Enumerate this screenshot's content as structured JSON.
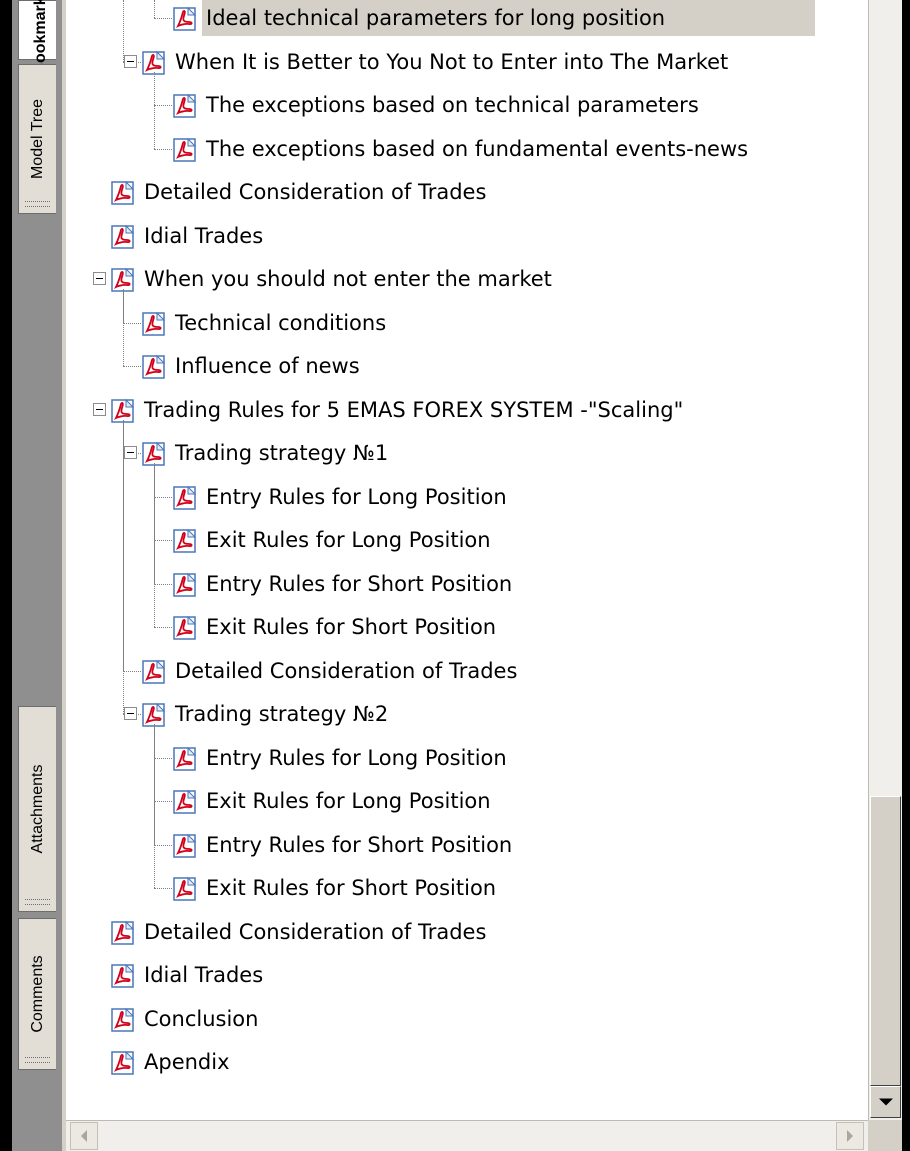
{
  "tabs": [
    {
      "label": "Bookmarks"
    },
    {
      "label": "Model Tree"
    },
    {
      "label": "Attachments"
    },
    {
      "label": "Comments"
    }
  ],
  "tree": [
    {
      "label": "Ideal technical parameters for long position",
      "level": 2,
      "expandable": false
    },
    {
      "label": "When It is Better to You Not to Enter into The Market",
      "level": 1,
      "expandable": true
    },
    {
      "label": "The exceptions based on technical parameters",
      "level": 2,
      "expandable": false
    },
    {
      "label": "The exceptions based on fundamental events-news",
      "level": 2,
      "expandable": false
    },
    {
      "label": "Detailed Consideration of Trades",
      "level": 0,
      "expandable": false
    },
    {
      "label": "Idial Trades",
      "level": 0,
      "expandable": false
    },
    {
      "label": "When you should not enter the market",
      "level": 0,
      "expandable": true
    },
    {
      "label": "Technical conditions",
      "level": 1,
      "expandable": false
    },
    {
      "label": "Influence of news",
      "level": 1,
      "expandable": false
    },
    {
      "label": "Trading Rules for 5 EMAS FOREX SYSTEM -\"Scaling\"",
      "level": 0,
      "expandable": true
    },
    {
      "label": "Trading strategy №1",
      "level": 1,
      "expandable": true
    },
    {
      "label": "Entry Rules for Long Position",
      "level": 2,
      "expandable": false
    },
    {
      "label": "Exit Rules for Long Position",
      "level": 2,
      "expandable": false
    },
    {
      "label": "Entry Rules for Short Position",
      "level": 2,
      "expandable": false
    },
    {
      "label": "Exit Rules for Short Position",
      "level": 2,
      "expandable": false
    },
    {
      "label": "Detailed Consideration of Trades",
      "level": 1,
      "expandable": false
    },
    {
      "label": "Trading strategy №2",
      "level": 1,
      "expandable": true
    },
    {
      "label": "Entry Rules for Long Position",
      "level": 2,
      "expandable": false
    },
    {
      "label": "Exit Rules for Long Position",
      "level": 2,
      "expandable": false
    },
    {
      "label": "Entry Rules for Short Position",
      "level": 2,
      "expandable": false
    },
    {
      "label": "Exit Rules for Short Position",
      "level": 2,
      "expandable": false
    },
    {
      "label": "Detailed Consideration of Trades",
      "level": 0,
      "expandable": false
    },
    {
      "label": "Idial Trades",
      "level": 0,
      "expandable": false
    },
    {
      "label": "Conclusion",
      "level": 0,
      "expandable": false
    },
    {
      "label": "Apendix",
      "level": 0,
      "expandable": false
    }
  ],
  "selected_index": 0,
  "colors": {
    "icon_red": "#d0021b",
    "icon_frame": "#4a76b8",
    "selection": "#d4d0c8"
  }
}
